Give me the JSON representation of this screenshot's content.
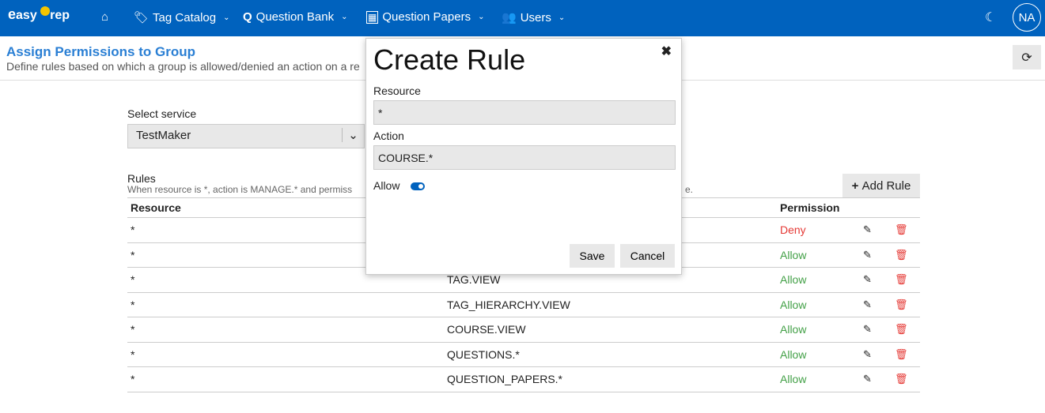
{
  "nav": {
    "logo": "easy Prep",
    "items": [
      {
        "icon": "tag-icon",
        "label": "Tag Catalog"
      },
      {
        "icon": "question-icon",
        "label": "Question Bank"
      },
      {
        "icon": "paper-icon",
        "label": "Question Papers"
      },
      {
        "icon": "users-icon",
        "label": "Users"
      }
    ],
    "avatar": "NA"
  },
  "page": {
    "title": "Assign Permissions to Group",
    "subtitle": "Define rules based on which a group is allowed/denied an action on a re",
    "service_label": "Select service",
    "service_value": "TestMaker",
    "rules_label": "Rules",
    "rules_hint_left": "When resource is *, action is MANAGE.* and permiss",
    "rules_hint_right": "e.",
    "add_rule": "Add Rule"
  },
  "table": {
    "headers": [
      "Resource",
      "Permission"
    ],
    "rows": [
      {
        "resource": "*",
        "action": "",
        "permission": "Deny"
      },
      {
        "resource": "*",
        "action": "",
        "permission": "Allow"
      },
      {
        "resource": "*",
        "action": "TAG.VIEW",
        "permission": "Allow"
      },
      {
        "resource": "*",
        "action": "TAG_HIERARCHY.VIEW",
        "permission": "Allow"
      },
      {
        "resource": "*",
        "action": "COURSE.VIEW",
        "permission": "Allow"
      },
      {
        "resource": "*",
        "action": "QUESTIONS.*",
        "permission": "Allow"
      },
      {
        "resource": "*",
        "action": "QUESTION_PAPERS.*",
        "permission": "Allow"
      }
    ]
  },
  "modal": {
    "title": "Create Rule",
    "resource_label": "Resource",
    "resource_value": "*",
    "action_label": "Action",
    "action_value": "COURSE.*",
    "allow_label": "Allow",
    "allow": true,
    "save": "Save",
    "cancel": "Cancel"
  }
}
